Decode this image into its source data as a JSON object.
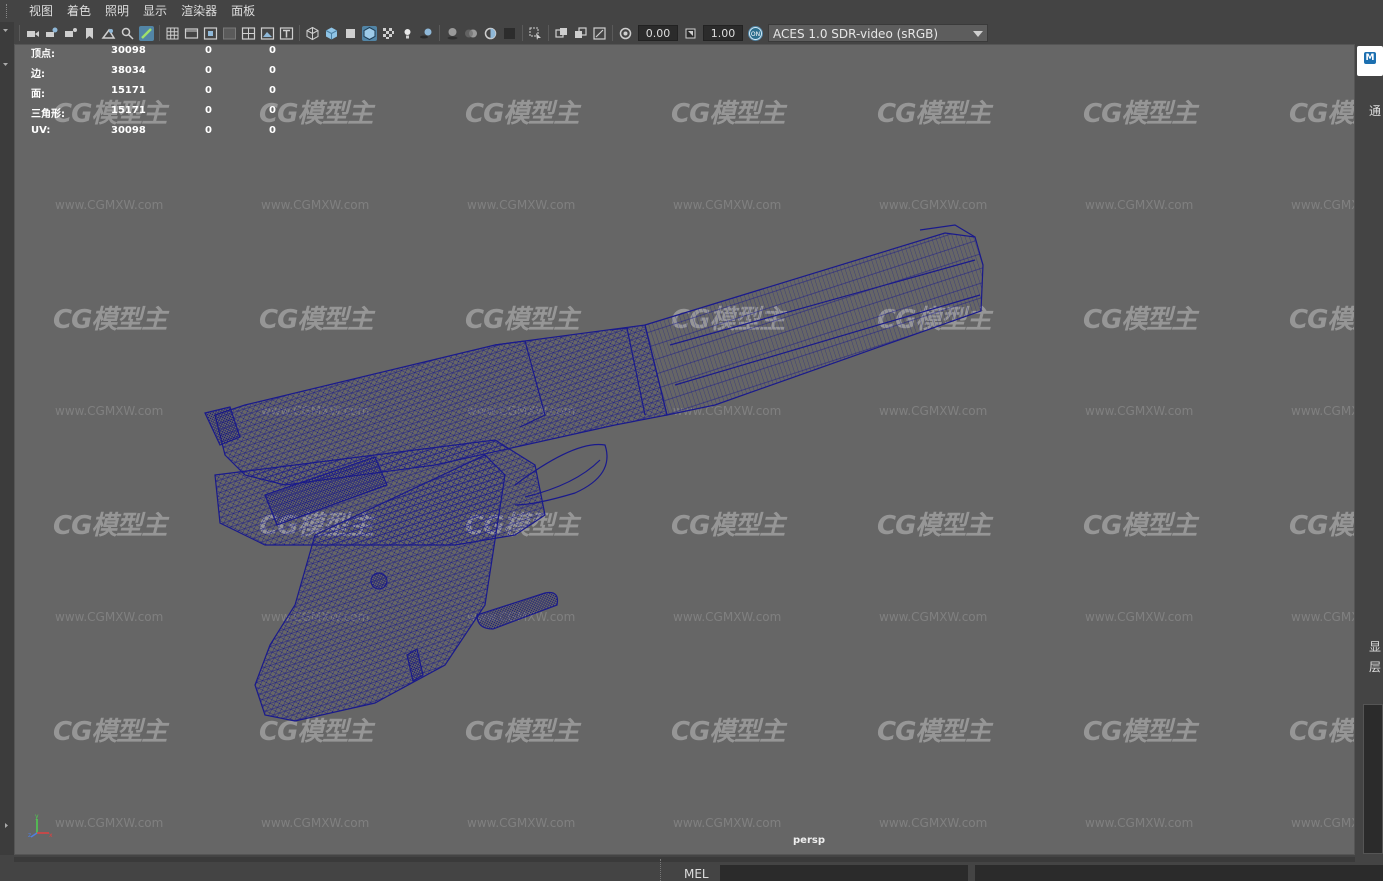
{
  "menubar": {
    "items": [
      "视图",
      "着色",
      "照明",
      "显示",
      "渲染器",
      "面板"
    ]
  },
  "toolbar": {
    "exposure_value": "0.00",
    "gamma_value": "1.00",
    "color_space": "ACES 1.0 SDR-video (sRGB)"
  },
  "hud": {
    "rows": [
      {
        "label": "顶点:",
        "v1": "30098",
        "v2": "0",
        "v3": "0"
      },
      {
        "label": "边:",
        "v1": "38034",
        "v2": "0",
        "v3": "0"
      },
      {
        "label": "面:",
        "v1": "15171",
        "v2": "0",
        "v3": "0"
      },
      {
        "label": "三角形:",
        "v1": "15171",
        "v2": "0",
        "v3": "0"
      },
      {
        "label": "UV:",
        "v1": "30098",
        "v2": "0",
        "v3": "0"
      }
    ]
  },
  "watermark": {
    "logo": "CG模型主",
    "url": "www.CGMXW.com"
  },
  "viewport": {
    "camera": "persp",
    "wire_color": "#1a1a8c",
    "background": "#666666"
  },
  "right_panel": {
    "badge": "M",
    "labels": [
      "通",
      "显",
      "层"
    ]
  },
  "bottombar": {
    "command_type": "MEL"
  }
}
